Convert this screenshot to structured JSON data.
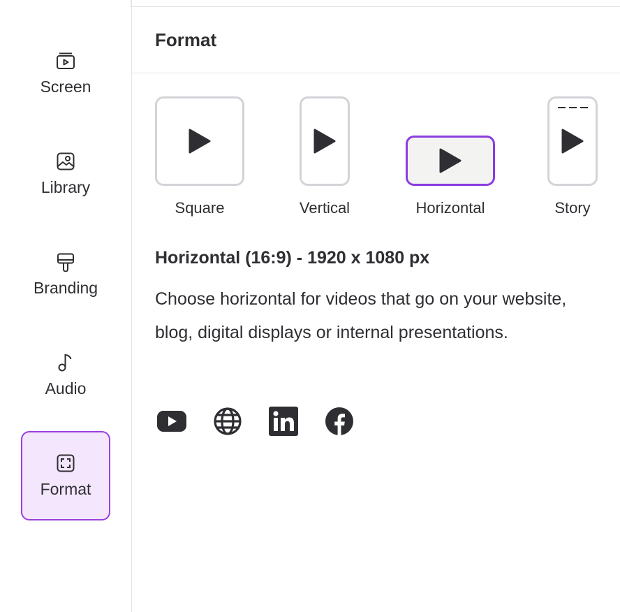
{
  "sidebar": {
    "items": [
      {
        "label": "Screen",
        "icon": "screen-icon",
        "active": false
      },
      {
        "label": "Library",
        "icon": "library-icon",
        "active": false
      },
      {
        "label": "Branding",
        "icon": "branding-icon",
        "active": false
      },
      {
        "label": "Audio",
        "icon": "audio-icon",
        "active": false
      },
      {
        "label": "Format",
        "icon": "format-icon",
        "active": true
      }
    ]
  },
  "panel": {
    "title": "Format"
  },
  "formats": [
    {
      "label": "Square",
      "selected": false
    },
    {
      "label": "Vertical",
      "selected": false
    },
    {
      "label": "Horizontal",
      "selected": true
    },
    {
      "label": "Story",
      "selected": false
    }
  ],
  "description": {
    "title": "Horizontal (16:9) - 1920 x 1080 px",
    "text": "Choose horizontal for videos that go on your website, blog, digital displays or internal presentations."
  },
  "social_icons": [
    "youtube-icon",
    "globe-icon",
    "linkedin-icon",
    "facebook-icon"
  ],
  "colors": {
    "accent": "#8b3ce0",
    "active_bg": "#f3e6fd",
    "text": "#2f2f33",
    "border": "#d4d4d8"
  }
}
